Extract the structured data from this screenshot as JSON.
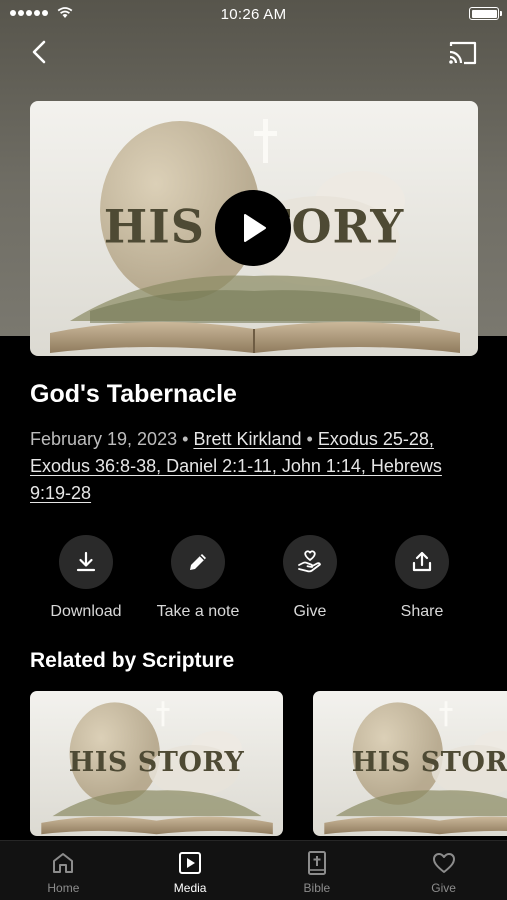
{
  "status_bar": {
    "time": "10:26 AM"
  },
  "header": {
    "back_icon": "chevron-left-icon",
    "cast_icon": "cast-icon"
  },
  "artwork": {
    "title": "HIS STORY",
    "play_icon": "play-icon"
  },
  "sermon": {
    "title": "God's Tabernacle",
    "date": "February 19, 2023",
    "separator": "•",
    "speaker": "Brett Kirkland",
    "scripture": "Exodus 25-28, Exodus 36:8-38, Daniel 2:1-11, John 1:14, Hebrews 9:19-28"
  },
  "actions": [
    {
      "label": "Download",
      "icon": "download-icon"
    },
    {
      "label": "Take a note",
      "icon": "pencil-icon"
    },
    {
      "label": "Give",
      "icon": "give-hand-heart-icon"
    },
    {
      "label": "Share",
      "icon": "share-icon"
    }
  ],
  "related": {
    "title": "Related by Scripture",
    "items": [
      {
        "title": "HIS STORY"
      },
      {
        "title": "HIS STORY"
      }
    ]
  },
  "tabbar": {
    "active": "Media",
    "tabs": [
      {
        "label": "Home",
        "icon": "home-icon"
      },
      {
        "label": "Media",
        "icon": "media-play-icon"
      },
      {
        "label": "Bible",
        "icon": "bible-icon"
      },
      {
        "label": "Give",
        "icon": "heart-icon"
      }
    ]
  },
  "colors": {
    "background": "#000000",
    "tab_inactive": "#8c8c8c",
    "action_circle": "#2a2a2a"
  }
}
